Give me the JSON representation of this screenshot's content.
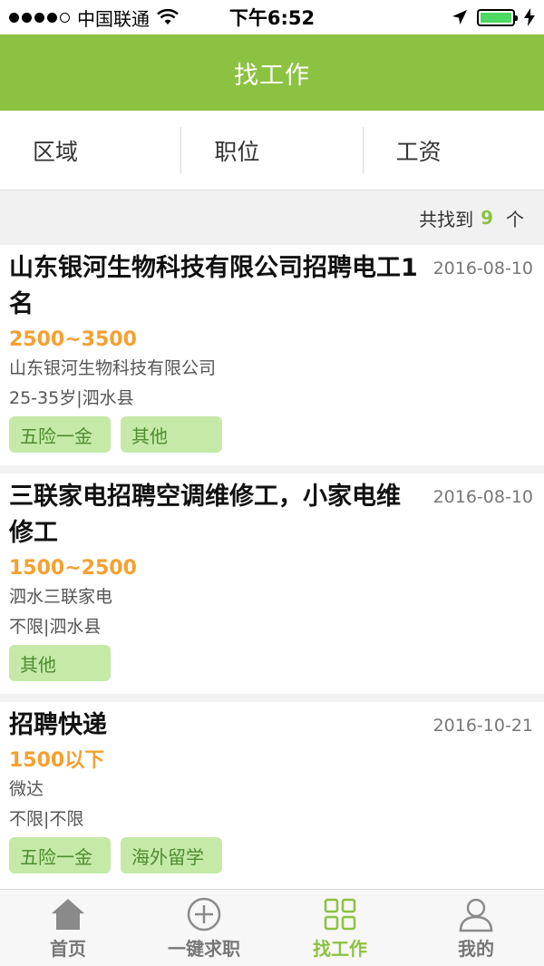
{
  "status_bar": {
    "carrier": "中国联通",
    "time": "下午6:52"
  },
  "header": {
    "title": "找工作"
  },
  "filters": [
    {
      "label": "区域"
    },
    {
      "label": "职位"
    },
    {
      "label": "工资"
    }
  ],
  "result_count": {
    "prefix": "共找到",
    "count": "9",
    "suffix": "个"
  },
  "jobs": [
    {
      "title": "山东银河生物科技有限公司招聘电工1名",
      "date": "2016-08-10",
      "salary": "2500~3500",
      "company": "山东银河生物科技有限公司",
      "meta": "25-35岁|泗水县",
      "tags": [
        "五险一金",
        "其他"
      ]
    },
    {
      "title": "三联家电招聘空调维修工，小家电维修工",
      "date": "2016-08-10",
      "salary": "1500~2500",
      "company": "泗水三联家电",
      "meta": "不限|泗水县",
      "tags": [
        "其他"
      ]
    },
    {
      "title": "招聘快递",
      "date": "2016-10-21",
      "salary": "1500以下",
      "company": "微达",
      "meta": "不限|不限",
      "tags": [
        "五险一金",
        "海外留学"
      ]
    }
  ],
  "tab_bar": [
    {
      "label": "首页",
      "icon": "home-icon",
      "active": false
    },
    {
      "label": "一键求职",
      "icon": "plus-circle-icon",
      "active": false
    },
    {
      "label": "找工作",
      "icon": "grid-icon",
      "active": true
    },
    {
      "label": "我的",
      "icon": "user-icon",
      "active": false
    }
  ],
  "colors": {
    "accent": "#8cc241",
    "salary": "#f5a030",
    "tag_bg": "#c5eaa8",
    "tag_text": "#4e8c2e"
  }
}
